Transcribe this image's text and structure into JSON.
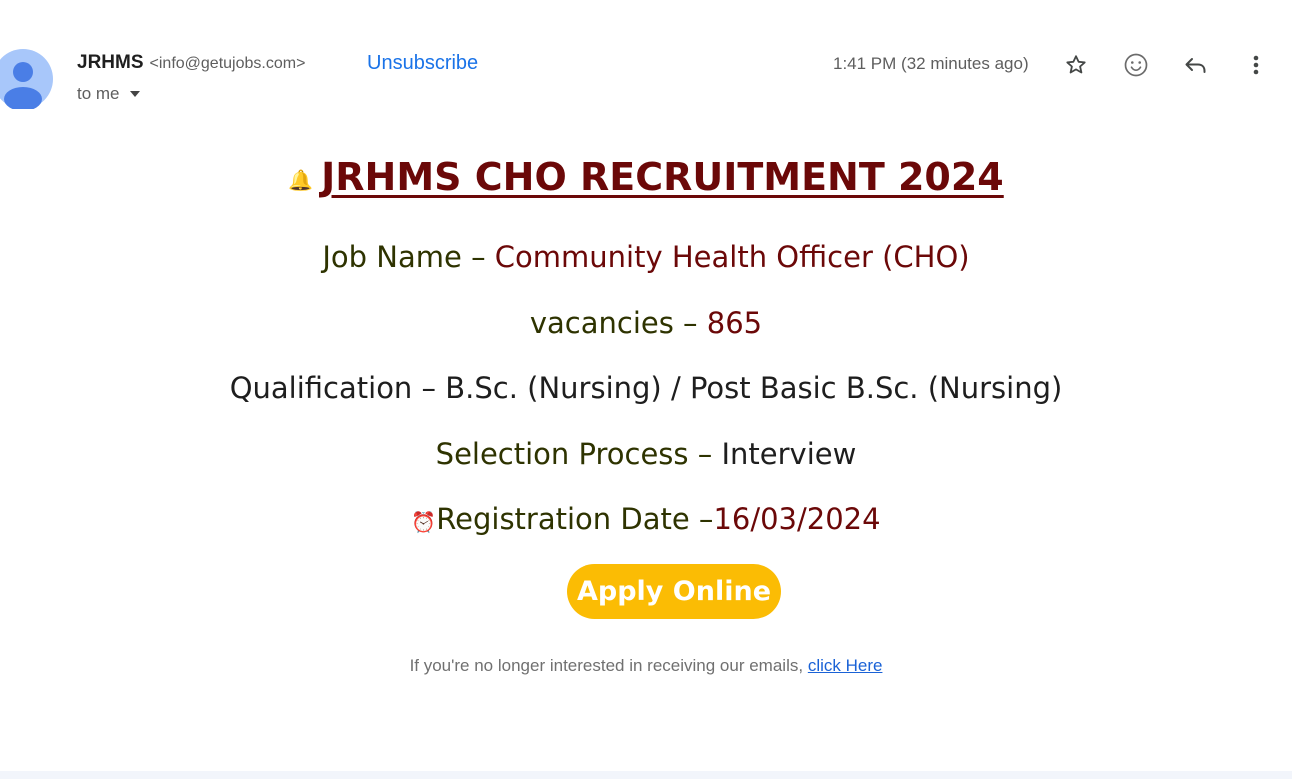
{
  "top_cut_text": "",
  "sender": {
    "name": "JRHMS",
    "email": "<info@getujobs.com>",
    "unsubscribe_label": "Unsubscribe",
    "recipient_label": "to me"
  },
  "timestamp": "1:41 PM (32 minutes ago)",
  "toolbar": {
    "star": "star-icon",
    "emoji": "add-reaction-icon",
    "reply": "reply-icon",
    "more": "more-options-icon"
  },
  "email_body": {
    "headline": "JRHMS CHO RECRUITMENT 2024",
    "job_name_label": "Job Name –",
    "job_name_value": "Community Health Officer (CHO)",
    "vacancies_label": "vacancies –",
    "vacancies_value": "865",
    "qualification_label": "Qualification –",
    "qualification_value": "B.Sc. (Nursing) / Post Basic B.Sc. (Nursing)",
    "selection_label": "Selection Process –",
    "selection_value": "Interview",
    "registration_label": "Registration Date –",
    "registration_value": "16/03/2024",
    "apply_label": "Apply Online",
    "footer_text": "If you're no longer interested in receiving our emails,",
    "footer_link": "click Here"
  },
  "colors": {
    "accent_link": "#1a73e8",
    "button": "#fbbc04",
    "headline": "#6b0808"
  }
}
